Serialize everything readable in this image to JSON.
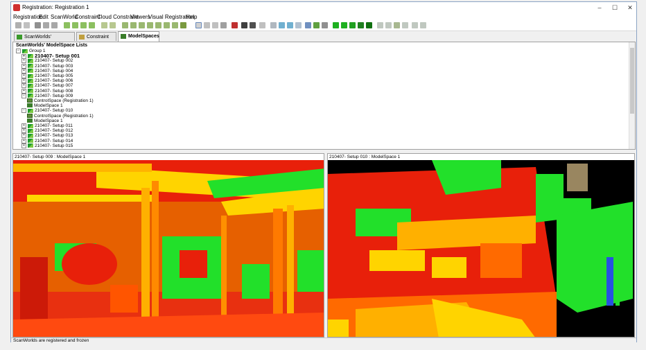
{
  "window": {
    "title": "Registration: Registration 1",
    "controls": [
      "–",
      "☐",
      "✕"
    ]
  },
  "menu": [
    "Registration",
    "Edit",
    "ScanWorld",
    "Constraint",
    "Cloud Constraint",
    "Viewers",
    "Visual Registration",
    "Help"
  ],
  "tabs": [
    {
      "label": "ScanWorlds' Constraints",
      "active": false
    },
    {
      "label": "Constraint List",
      "active": false
    },
    {
      "label": "ModelSpaces",
      "active": true
    }
  ],
  "tree": {
    "header": "ScanWorlds' ModelSpace Lists",
    "rows": [
      {
        "label": "Group 1",
        "level": 0,
        "kind": "group",
        "exp": "−"
      },
      {
        "label": "210407- Setup 001",
        "level": 1,
        "kind": "sw",
        "exp": "+",
        "bold": true
      },
      {
        "label": "210407- Setup 002",
        "level": 1,
        "kind": "sw",
        "exp": "+"
      },
      {
        "label": "210407- Setup 003",
        "level": 1,
        "kind": "sw",
        "exp": "+"
      },
      {
        "label": "210407- Setup 004",
        "level": 1,
        "kind": "sw",
        "exp": "+"
      },
      {
        "label": "210407- Setup 005",
        "level": 1,
        "kind": "sw",
        "exp": "+"
      },
      {
        "label": "210407- Setup 006",
        "level": 1,
        "kind": "sw",
        "exp": "+"
      },
      {
        "label": "210407- Setup 007",
        "level": 1,
        "kind": "sw",
        "exp": "+"
      },
      {
        "label": "210407- Setup 008",
        "level": 1,
        "kind": "sw",
        "exp": "+"
      },
      {
        "label": "210407- Setup 009",
        "level": 1,
        "kind": "sw",
        "exp": "−"
      },
      {
        "label": "ControlSpace (Registration 1)",
        "level": 2,
        "kind": "cs"
      },
      {
        "label": "ModelSpace 1",
        "level": 2,
        "kind": "ms"
      },
      {
        "label": "210407- Setup 010",
        "level": 1,
        "kind": "sw",
        "exp": "−"
      },
      {
        "label": "ControlSpace (Registration 1)",
        "level": 2,
        "kind": "cs"
      },
      {
        "label": "ModelSpace 1",
        "level": 2,
        "kind": "ms"
      },
      {
        "label": "210407- Setup 011",
        "level": 1,
        "kind": "sw",
        "exp": "+"
      },
      {
        "label": "210407- Setup 012",
        "level": 1,
        "kind": "sw",
        "exp": "+"
      },
      {
        "label": "210407- Setup 013",
        "level": 1,
        "kind": "sw",
        "exp": "+"
      },
      {
        "label": "210407- Setup 014",
        "level": 1,
        "kind": "sw",
        "exp": "+"
      },
      {
        "label": "210407- Setup 015",
        "level": 1,
        "kind": "sw",
        "exp": "+"
      }
    ]
  },
  "viewers": {
    "left_label": "210407- Setup 009 : ModelSpace 1",
    "right_label": "210407- Setup 010 : ModelSpace 1"
  },
  "status": "ScanWorlds are registered and frozen",
  "colors": {
    "red": "#e8200a",
    "orange": "#ff6a00",
    "yellow": "#ffd400",
    "green": "#22e02a",
    "black": "#000000"
  }
}
